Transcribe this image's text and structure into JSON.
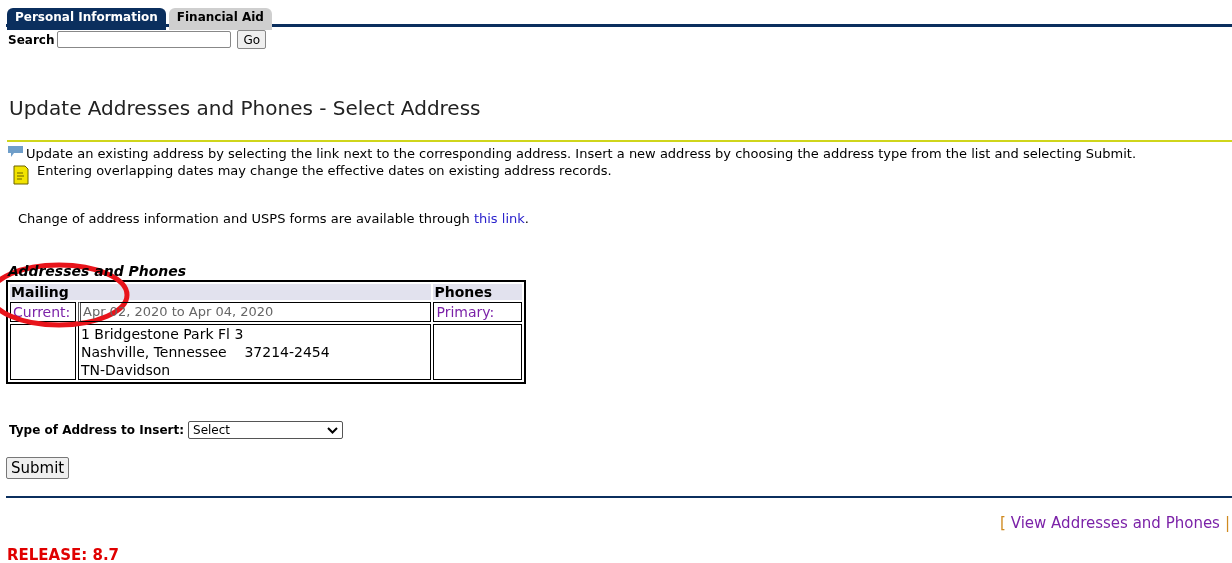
{
  "tabs": [
    {
      "label": "Personal Information",
      "selected": true
    },
    {
      "label": "Financial Aid",
      "selected": false
    }
  ],
  "search": {
    "label": "Search",
    "button": "Go"
  },
  "title": "Update Addresses and Phones - Select Address",
  "info": [
    {
      "kind": "info",
      "text": "Update an existing address by selecting the link next to the corresponding address. Insert a new address by choosing the address type from the list and selecting Submit."
    },
    {
      "kind": "note",
      "text": "Entering overlapping dates may change the effective dates on existing address records."
    }
  ],
  "usps": {
    "text": "Change of address information and USPS forms are available through",
    "link": "this link",
    "end": "."
  },
  "table": {
    "caption": "Addresses and Phones",
    "headers": [
      "Mailing",
      "Phones"
    ],
    "mailing": {
      "status": "Current:",
      "dates": "Apr 02, 2020 to Apr 04, 2020",
      "lines": [
        "1 Bridgestone Park Fl 3",
        "Nashville, Tennessee    37214-2454",
        "TN-Davidson"
      ]
    },
    "phones": {
      "label": "Primary:"
    }
  },
  "insert": {
    "label": "Type of Address to Insert:",
    "value": "Select"
  },
  "submit": "Submit",
  "nav": {
    "open": "[",
    "link": "View Addresses and Phones",
    "sep": "|"
  },
  "release": "RELEASE: 8.7"
}
